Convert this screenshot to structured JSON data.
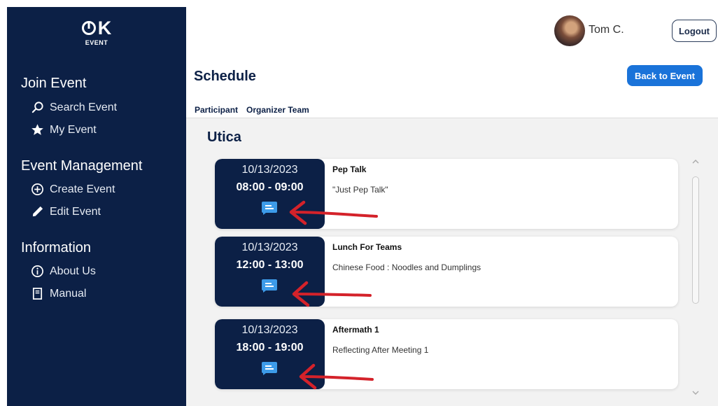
{
  "brand": {
    "mark": "K",
    "sub": "EVENT"
  },
  "sidebar": {
    "sections": [
      {
        "title": "Join Event",
        "items": [
          {
            "label": "Search Event",
            "icon": "search-icon"
          },
          {
            "label": "My Event",
            "icon": "star-icon"
          }
        ]
      },
      {
        "title": "Event Management",
        "items": [
          {
            "label": "Create Event",
            "icon": "plus-circle-icon"
          },
          {
            "label": "Edit Event",
            "icon": "pencil-icon"
          }
        ]
      },
      {
        "title": "Information",
        "items": [
          {
            "label": "About Us",
            "icon": "info-icon"
          },
          {
            "label": "Manual",
            "icon": "book-icon"
          }
        ]
      }
    ]
  },
  "header": {
    "user_name": "Tom C.",
    "logout_label": "Logout"
  },
  "page": {
    "title": "Schedule",
    "back_label": "Back to Event",
    "tabs": [
      {
        "label": "Participant",
        "active": false
      },
      {
        "label": "Organizer Team",
        "active": true
      }
    ],
    "city": "Utica"
  },
  "events": [
    {
      "date": "10/13/2023",
      "time": "08:00 - 09:00",
      "title": "Pep Talk",
      "description": "\"Just Pep Talk\""
    },
    {
      "date": "10/13/2023",
      "time": "12:00 - 13:00",
      "title": "Lunch For Teams",
      "description": "Chinese Food : Noodles and Dumplings"
    },
    {
      "date": "10/13/2023",
      "time": "18:00 - 19:00",
      "title": "Aftermath 1",
      "description": "Reflecting After Meeting 1"
    }
  ],
  "colors": {
    "sidebar": "#0c2046",
    "accent": "#1a73d9",
    "chat_icon": "#3d9be9",
    "annotation_arrow": "#d4222a",
    "content_bg": "#f2f2f2"
  }
}
